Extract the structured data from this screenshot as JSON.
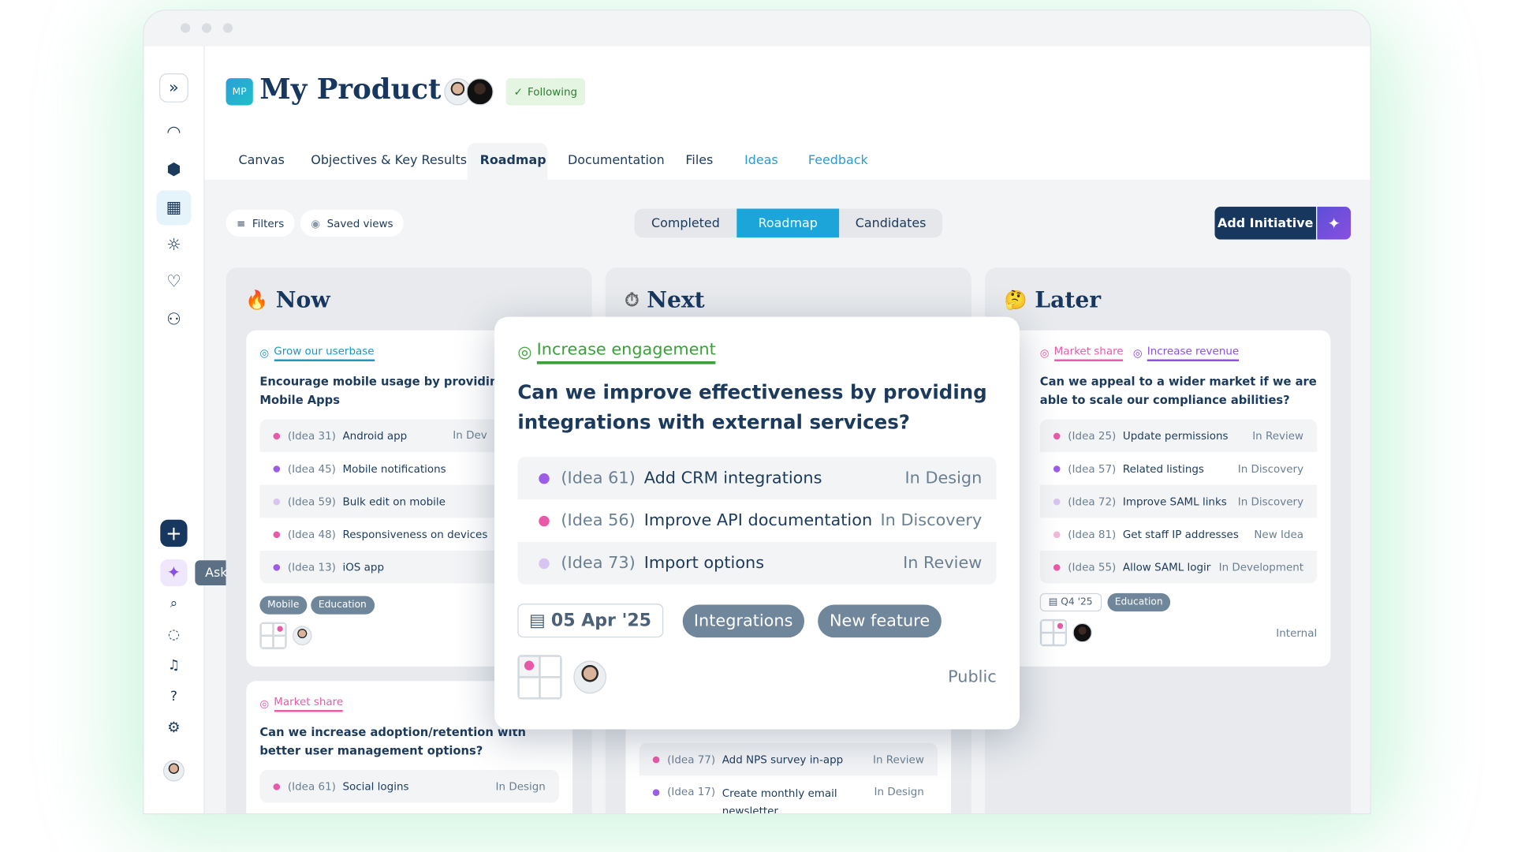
{
  "colors": {
    "accent": "#1ba5d8",
    "navy": "#17375e",
    "pink": "#e85aa8",
    "purple": "#9b5de5",
    "lightPurple": "#d8c4f0",
    "lightPink": "#f2b8d6",
    "green": "#3aa13a"
  },
  "header": {
    "badge": "MP",
    "title": "My Product",
    "following": "Following"
  },
  "tabs": [
    "Canvas",
    "Objectives & Key Results",
    "Roadmap",
    "Documentation",
    "Files",
    "Ideas",
    "Feedback"
  ],
  "toolbar": {
    "filters": "Filters",
    "saved_views": "Saved views",
    "segments": [
      "Completed",
      "Roadmap",
      "Candidates"
    ],
    "add_initiative": "Add Initiative"
  },
  "sidebar": {
    "tooltip": "Ask CoPilot",
    "icons": [
      "expand-icon",
      "dashboard-icon",
      "cubes-icon",
      "roadmap-icon",
      "idea-icon",
      "feedback-icon",
      "people-icon",
      "plus-icon",
      "copilot-sparkle-icon",
      "search-icon",
      "chat-icon",
      "bell-icon",
      "help-icon",
      "gear-icon"
    ]
  },
  "columns": {
    "now": {
      "title": "Now",
      "emoji": "🔥",
      "card1": {
        "goals": [
          "Grow our userbase"
        ],
        "question": "Encourage mobile usage by providing iPad Mobile Apps",
        "ideas": [
          {
            "id": "(Idea 31)",
            "title": "Android app",
            "status": "In Dev"
          },
          {
            "id": "(Idea 45)",
            "title": "Mobile notifications",
            "status": ""
          },
          {
            "id": "(Idea 59)",
            "title": "Bulk edit on mobile",
            "status": ""
          },
          {
            "id": "(Idea 48)",
            "title": "Responsiveness on devices",
            "status": ""
          },
          {
            "id": "(Idea 13)",
            "title": "iOS app",
            "status": ""
          }
        ],
        "tags": [
          "Mobile",
          "Education"
        ]
      },
      "card2": {
        "goals": [
          "Market share"
        ],
        "question": "Can we increase adoption/retention with better user management options?",
        "ideas": [
          {
            "id": "(Idea 61)",
            "title": "Social logins",
            "status": "In Design"
          }
        ]
      }
    },
    "next": {
      "title": "Next",
      "emoji": "⏱",
      "ideas": [
        {
          "id": "(Idea 77)",
          "title": "Add NPS survey in-app",
          "status": "In Review"
        },
        {
          "id": "(Idea 17)",
          "title": "Create monthly email newsletter",
          "status": "In Design"
        }
      ]
    },
    "later": {
      "title": "Later",
      "emoji": "🤔",
      "card": {
        "goals": [
          "Market share",
          "Increase revenue"
        ],
        "question": "Can we appeal to a wider market if we are able to scale our compliance abilities?",
        "ideas": [
          {
            "id": "(Idea 25)",
            "title": "Update permissions",
            "status": "In Review"
          },
          {
            "id": "(Idea 57)",
            "title": "Related listings",
            "status": "In Discovery"
          },
          {
            "id": "(Idea 72)",
            "title": "Improve SAML links",
            "status": "In Discovery"
          },
          {
            "id": "(Idea 81)",
            "title": "Get staff IP addresses",
            "status": "New Idea"
          },
          {
            "id": "(Idea 55)",
            "title": "Allow SAML login",
            "status": "In Development"
          }
        ],
        "date": "Q4 '25",
        "tags": [
          "Education"
        ],
        "visibility": "Internal"
      }
    }
  },
  "popup": {
    "goal": "Increase engagement",
    "question": "Can we improve effectiveness by providing integrations with external services?",
    "ideas": [
      {
        "id": "(Idea 61)",
        "title": "Add CRM integrations",
        "status": "In Design"
      },
      {
        "id": "(Idea 56)",
        "title": "Improve API documentation",
        "status": "In Discovery"
      },
      {
        "id": "(Idea 73)",
        "title": "Import options",
        "status": "In Review"
      }
    ],
    "date": "05 Apr '25",
    "tags": [
      "Integrations",
      "New feature"
    ],
    "visibility": "Public"
  }
}
